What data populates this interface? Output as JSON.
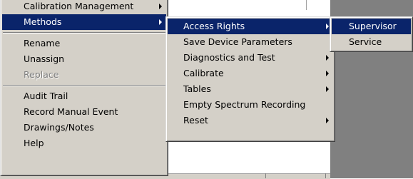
{
  "context_menu": {
    "items": [
      {
        "label": "Calibration Management",
        "submenu": true
      },
      {
        "label": "Methods",
        "submenu": true,
        "selected": true
      },
      {
        "label": "Rename"
      },
      {
        "label": "Unassign"
      },
      {
        "label": "Replace",
        "disabled": true
      },
      {
        "label": "Audit Trail"
      },
      {
        "label": "Record Manual Event"
      },
      {
        "label": "Drawings/Notes"
      },
      {
        "label": "Help"
      }
    ]
  },
  "methods_submenu": {
    "items": [
      {
        "label": "Access Rights",
        "submenu": true,
        "selected": true
      },
      {
        "label": "Save Device Parameters"
      },
      {
        "label": "Diagnostics and Test",
        "submenu": true
      },
      {
        "label": "Calibrate",
        "submenu": true
      },
      {
        "label": "Tables",
        "submenu": true
      },
      {
        "label": "Empty Spectrum Recording"
      },
      {
        "label": "Reset",
        "submenu": true
      }
    ]
  },
  "access_rights_submenu": {
    "items": [
      {
        "label": "Supervisor",
        "selected": true
      },
      {
        "label": "Service"
      }
    ]
  },
  "colors": {
    "menu_bg": "#d4d0c8",
    "highlight": "#0a246a",
    "disabled_text": "#808080",
    "background_dark": "#808080"
  }
}
